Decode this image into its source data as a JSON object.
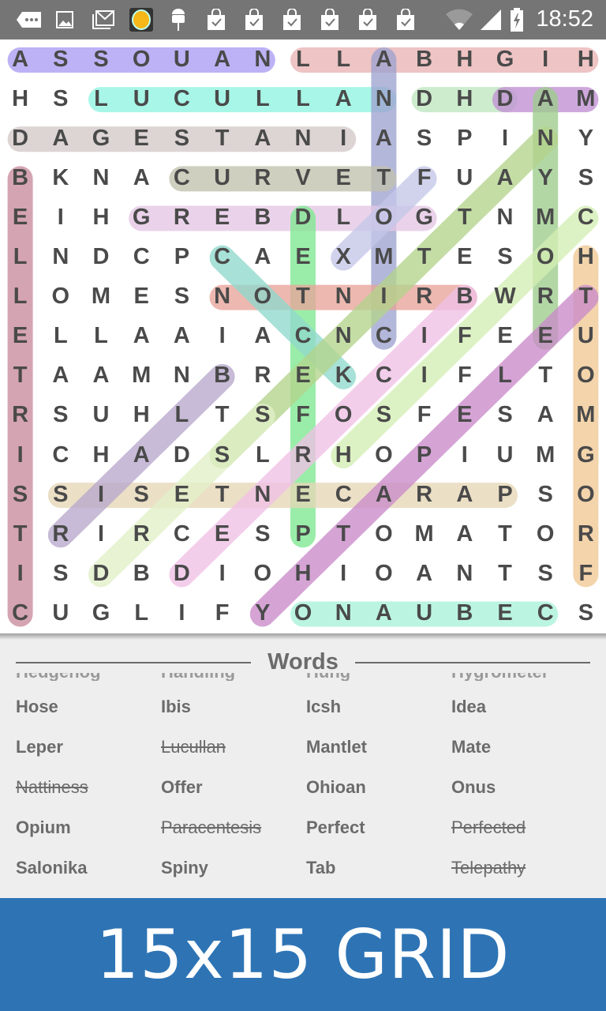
{
  "status_bar": {
    "time": "18:52",
    "icons": [
      "more-notifications-icon",
      "image-icon",
      "gmail-icon",
      "app-icon",
      "android-icon",
      "shopping-bag-check-icon",
      "shopping-bag-check-icon",
      "shopping-bag-check-icon",
      "shopping-bag-check-icon",
      "shopping-bag-check-icon",
      "shopping-bag-check-icon",
      "wifi-icon",
      "cell-signal-icon",
      "battery-charging-icon"
    ]
  },
  "grid": {
    "size": 15,
    "rows": [
      "ASSOUANLLABHGIH",
      "HSLUCULLANDHDAM",
      "DAGESTANIASPINY",
      "BKNACURVETFUAYS",
      "EIHGREBDLOGTNMC",
      "LNDCPCAEXMTESOH",
      "LOMESNOTNIRBWRT",
      "ELLAAIACNCIFEEU",
      "TAAMNBREKCIFLTO",
      "RSUHLTSFOSFESAM",
      "ICHADSLRHOPIUMG",
      "SSISETNECARAPSO",
      "TRIRCESPTOMATOR",
      "ISDBDIOHIOANTSF",
      "CUGLIFYONAUBECS"
    ],
    "highlights": [
      {
        "from": [
          0,
          0
        ],
        "to": [
          0,
          6
        ],
        "color": "#a99cf2"
      },
      {
        "from": [
          0,
          7
        ],
        "to": [
          0,
          14
        ],
        "color": "#e9b4b4"
      },
      {
        "from": [
          1,
          2
        ],
        "to": [
          1,
          9
        ],
        "color": "#8ff3e0"
      },
      {
        "from": [
          1,
          10
        ],
        "to": [
          1,
          12
        ],
        "color": "#bfe6bf"
      },
      {
        "from": [
          1,
          12
        ],
        "to": [
          1,
          14
        ],
        "color": "#c08fd4"
      },
      {
        "from": [
          2,
          0
        ],
        "to": [
          2,
          8
        ],
        "color": "#d3c8c8"
      },
      {
        "from": [
          0,
          9
        ],
        "to": [
          7,
          9
        ],
        "color": "#9ea3cf"
      },
      {
        "from": [
          3,
          4
        ],
        "to": [
          3,
          9
        ],
        "color": "#c2c2ad"
      },
      {
        "from": [
          4,
          3
        ],
        "to": [
          4,
          10
        ],
        "color": "#e4c6e4"
      },
      {
        "from": [
          3,
          0
        ],
        "to": [
          14,
          0
        ],
        "color": "#c98a9c"
      },
      {
        "from": [
          4,
          7
        ],
        "to": [
          12,
          7
        ],
        "color": "#7ee88f"
      },
      {
        "from": [
          6,
          5
        ],
        "to": [
          6,
          11
        ],
        "color": "#e8a49a"
      },
      {
        "from": [
          5,
          14
        ],
        "to": [
          13,
          14
        ],
        "color": "#f0c894"
      },
      {
        "from": [
          1,
          13
        ],
        "to": [
          7,
          13
        ],
        "color": "#9ccc8c"
      },
      {
        "from": [
          11,
          1
        ],
        "to": [
          11,
          12
        ],
        "color": "#e6d6b6"
      },
      {
        "from": [
          14,
          7
        ],
        "to": [
          14,
          13
        ],
        "color": "#a8f2d8"
      },
      {
        "from": [
          5,
          5
        ],
        "to": [
          8,
          8
        ],
        "color": "#8fd8cc"
      },
      {
        "from": [
          3,
          10
        ],
        "to": [
          5,
          8
        ],
        "color": "#c4c6e8"
      },
      {
        "from": [
          8,
          5
        ],
        "to": [
          12,
          1
        ],
        "color": "#b7a8cc"
      },
      {
        "from": [
          10,
          5
        ],
        "to": [
          2,
          13
        ],
        "color": "#b4d48c"
      },
      {
        "from": [
          13,
          2
        ],
        "to": [
          9,
          6
        ],
        "color": "#e2f0c8"
      },
      {
        "from": [
          13,
          4
        ],
        "to": [
          6,
          11
        ],
        "color": "#f0c0e6"
      },
      {
        "from": [
          10,
          8
        ],
        "to": [
          4,
          14
        ],
        "color": "#d4eeb4"
      },
      {
        "from": [
          14,
          6
        ],
        "to": [
          6,
          14
        ],
        "color": "#c98ac9"
      }
    ]
  },
  "words_section": {
    "title": "Words",
    "cut_off_row": [
      "Hedgehog",
      "Handling",
      "Hung",
      "Hygrometer"
    ],
    "words": [
      {
        "text": "Hose",
        "found": false
      },
      {
        "text": "Ibis",
        "found": false
      },
      {
        "text": "Icsh",
        "found": false
      },
      {
        "text": "Idea",
        "found": false
      },
      {
        "text": "Leper",
        "found": false
      },
      {
        "text": "Lucullan",
        "found": true
      },
      {
        "text": "Mantlet",
        "found": false
      },
      {
        "text": "Mate",
        "found": false
      },
      {
        "text": "Nattiness",
        "found": true
      },
      {
        "text": "Offer",
        "found": false
      },
      {
        "text": "Ohioan",
        "found": false
      },
      {
        "text": "Onus",
        "found": false
      },
      {
        "text": "Opium",
        "found": false
      },
      {
        "text": "Paracentesis",
        "found": true
      },
      {
        "text": "Perfect",
        "found": false
      },
      {
        "text": "Perfected",
        "found": true
      },
      {
        "text": "Salonika",
        "found": false
      },
      {
        "text": "Spiny",
        "found": false
      },
      {
        "text": "Tab",
        "found": false
      },
      {
        "text": "Telepathy",
        "found": true
      }
    ]
  },
  "banner": {
    "text": "15x15 GRID",
    "color": "#2e74b5"
  }
}
